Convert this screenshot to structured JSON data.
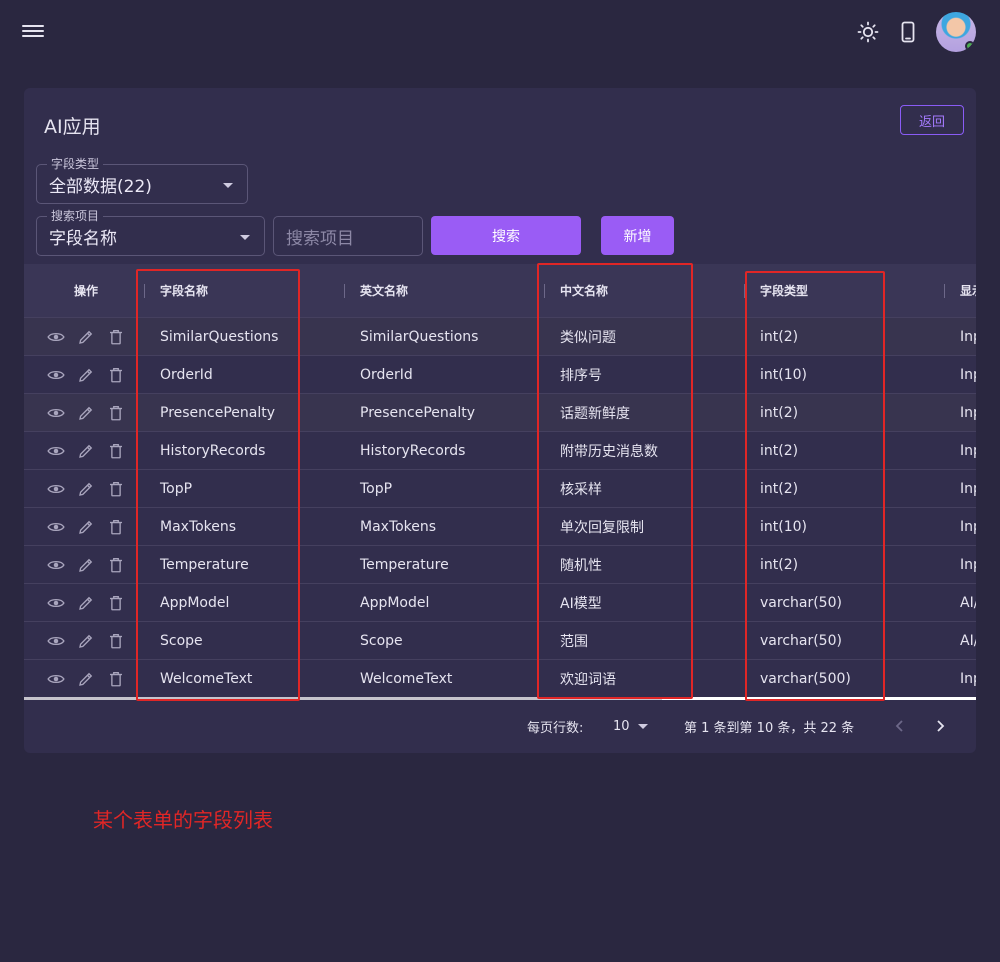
{
  "topbar": {
    "menu_icon": "hamburger-menu-icon",
    "theme_icon": "brightness-icon",
    "device_icon": "mobile-device-icon",
    "avatar_status_color": "#4caf50"
  },
  "page": {
    "title": "AI应用",
    "back_label": "返回"
  },
  "filters": {
    "field_type_label": "字段类型",
    "field_type_value": "全部数据(22)",
    "search_item_label": "搜索项目",
    "search_item_value": "字段名称",
    "search_placeholder": "搜索项目",
    "search_button": "搜索",
    "add_button": "新增"
  },
  "table": {
    "headers": [
      "操作",
      "字段名称",
      "英文名称",
      "中文名称",
      "字段类型",
      "显示"
    ],
    "rows": [
      {
        "field": "SimilarQuestions",
        "en": "SimilarQuestions",
        "cn": "类似问题",
        "type": "int(2)",
        "display": "Inp"
      },
      {
        "field": "OrderId",
        "en": "OrderId",
        "cn": "排序号",
        "type": "int(10)",
        "display": "Inp"
      },
      {
        "field": "PresencePenalty",
        "en": "PresencePenalty",
        "cn": "话题新鲜度",
        "type": "int(2)",
        "display": "Inp"
      },
      {
        "field": "HistoryRecords",
        "en": "HistoryRecords",
        "cn": "附带历史消息数",
        "type": "int(2)",
        "display": "Inp"
      },
      {
        "field": "TopP",
        "en": "TopP",
        "cn": "核采样",
        "type": "int(2)",
        "display": "Inp"
      },
      {
        "field": "MaxTokens",
        "en": "MaxTokens",
        "cn": "单次回复限制",
        "type": "int(10)",
        "display": "Inp"
      },
      {
        "field": "Temperature",
        "en": "Temperature",
        "cn": "随机性",
        "type": "int(2)",
        "display": "Inp"
      },
      {
        "field": "AppModel",
        "en": "AppModel",
        "cn": "AI模型",
        "type": "varchar(50)",
        "display": "AI/"
      },
      {
        "field": "Scope",
        "en": "Scope",
        "cn": "范围",
        "type": "varchar(50)",
        "display": "AI/"
      },
      {
        "field": "WelcomeText",
        "en": "WelcomeText",
        "cn": "欢迎词语",
        "type": "varchar(500)",
        "display": "Inp"
      }
    ]
  },
  "pagination": {
    "rows_per_page_label": "每页行数:",
    "rows_per_page_value": "10",
    "range_text": "第 1 条到第 10 条，共 22 条"
  },
  "annotation": "某个表单的字段列表",
  "colors": {
    "accent": "#9a5cf5",
    "highlight": "#e02626",
    "background": "#2a2740",
    "card": "#322e4d"
  }
}
